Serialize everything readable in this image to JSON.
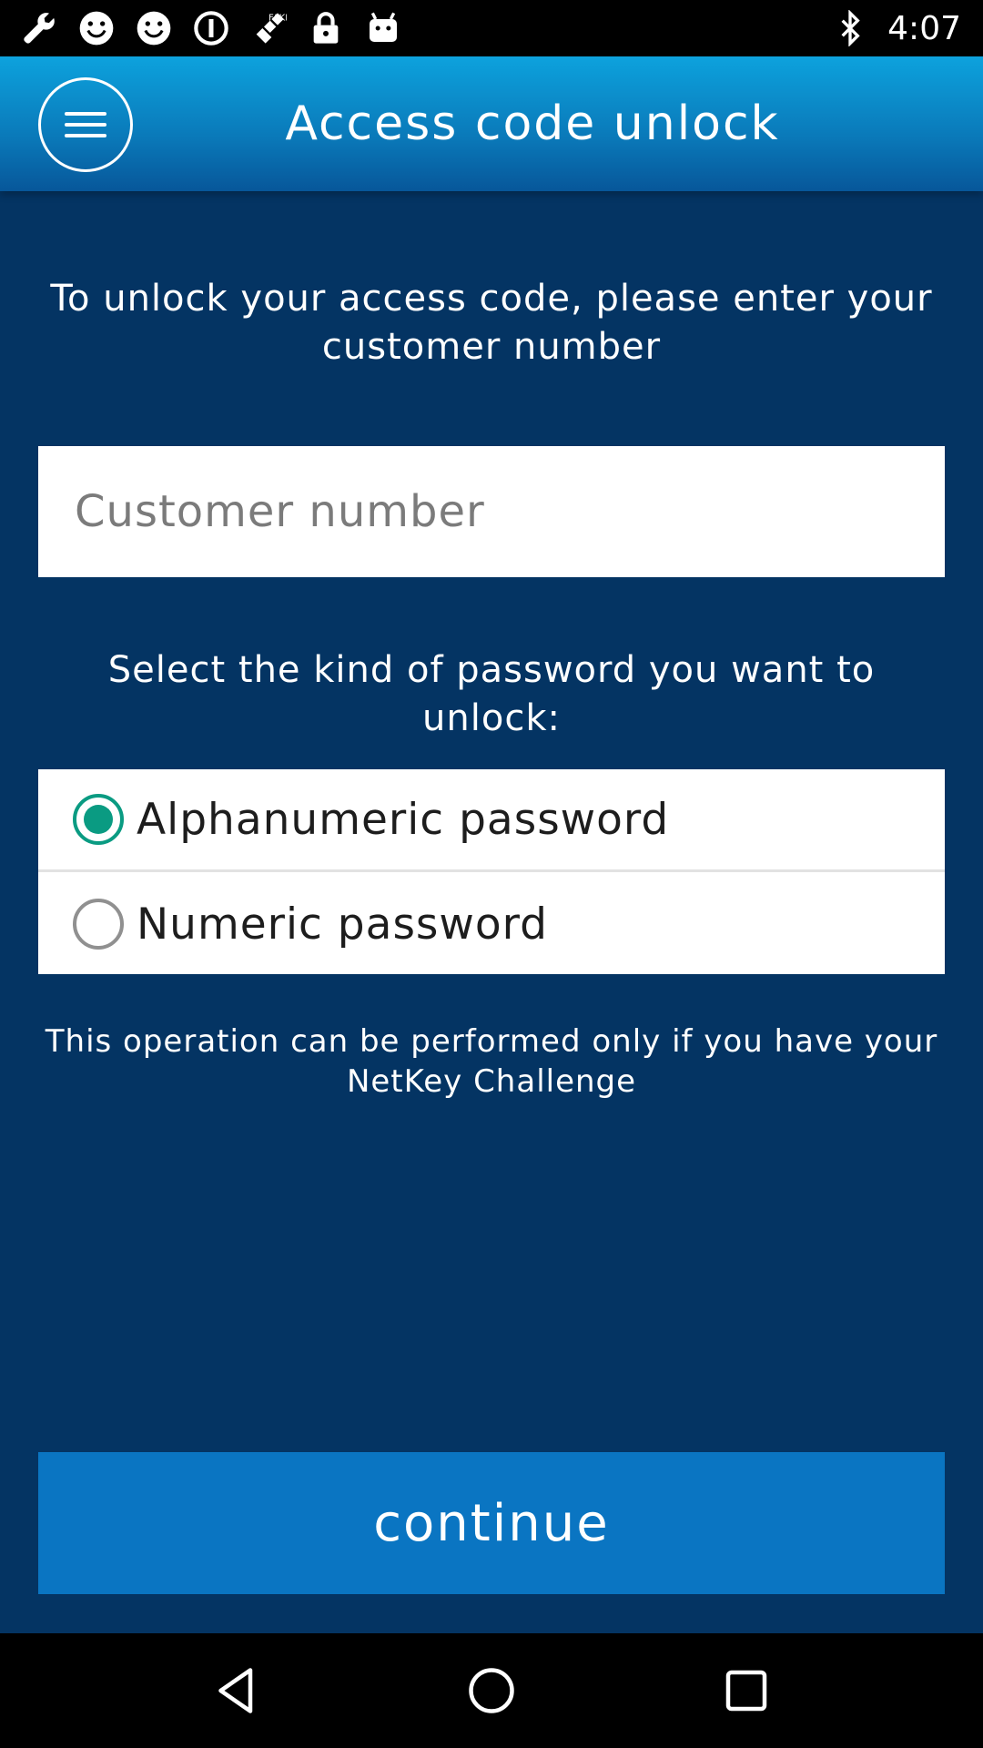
{
  "status_bar": {
    "time": "4:07",
    "left_icons": [
      "wrench-icon",
      "smiley-icon",
      "smiley-icon",
      "info-circle-icon",
      "fake-gps-icon",
      "lock-icon",
      "android-icon"
    ],
    "right_icons": [
      "bluetooth-icon"
    ]
  },
  "app_bar": {
    "title": "Access code unlock",
    "menu_icon": "hamburger-menu-icon"
  },
  "main": {
    "intro_text": "To unlock your access code, please enter your customer number",
    "customer_input": {
      "placeholder": "Customer number",
      "value": ""
    },
    "select_text": "Select the kind of password you want to unlock:",
    "password_options": [
      {
        "label": "Alphanumeric password",
        "selected": true
      },
      {
        "label": "Numeric password",
        "selected": false
      }
    ],
    "note_text": "This operation can be performed only if you have your NetKey Challenge",
    "continue_label": "continue"
  },
  "nav_bar": {
    "buttons": [
      "back-icon",
      "home-icon",
      "recents-icon"
    ]
  },
  "colors": {
    "background": "#043463",
    "app_bar": "#0a79b9",
    "accent_radio": "#0a9b82",
    "button": "#0a75c2"
  }
}
